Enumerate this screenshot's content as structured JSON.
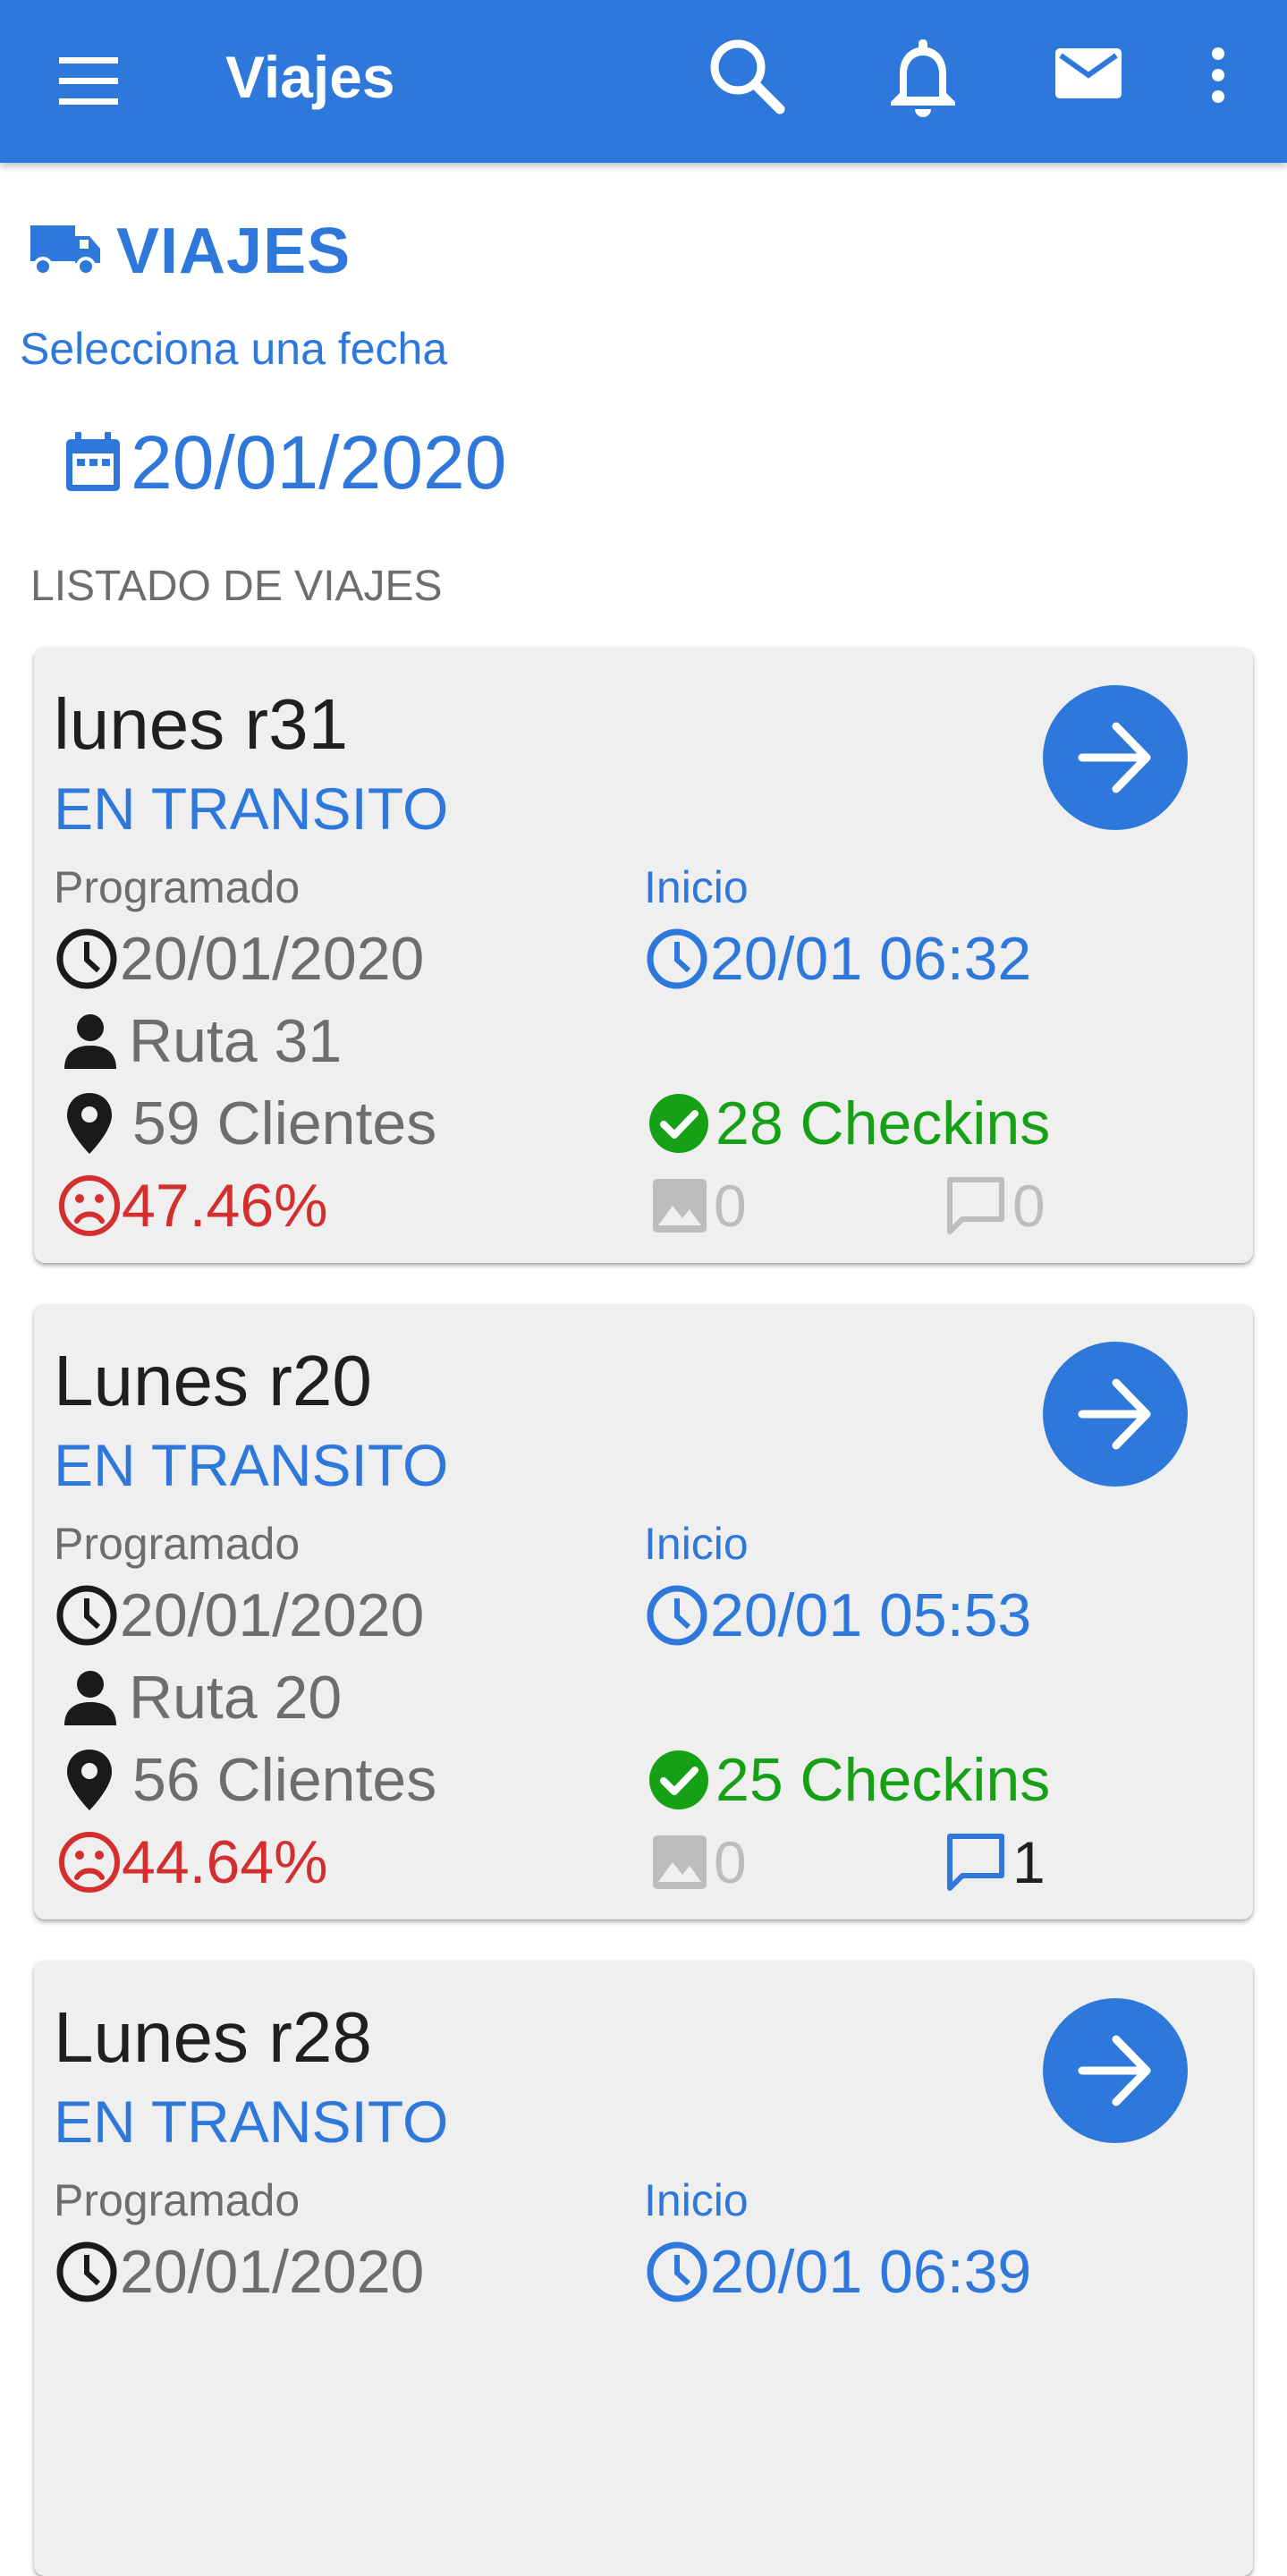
{
  "appbar": {
    "title": "Viajes",
    "icons": [
      "menu-icon",
      "search-icon",
      "bell-icon",
      "mail-icon",
      "more-vert-icon"
    ]
  },
  "section": {
    "title": "VIAJES",
    "icon": "truck-icon"
  },
  "date_select": {
    "label": "Selecciona una fecha",
    "value": "20/01/2020",
    "icon": "calendar-icon"
  },
  "list": {
    "header": "LISTADO DE VIAJES",
    "trips": [
      {
        "name": "lunes r31",
        "status": "EN TRANSITO",
        "scheduled_label": "Programado",
        "scheduled_date": "20/01/2020",
        "route": "Ruta 31",
        "clients": "59 Clientes",
        "percent": "47.46%",
        "start_label": "Inicio",
        "start_time": "20/01 06:32",
        "checkins": "28 Checkins",
        "photos": "0",
        "comments": "0"
      },
      {
        "name": "Lunes r20",
        "status": "EN TRANSITO",
        "scheduled_label": "Programado",
        "scheduled_date": "20/01/2020",
        "route": "Ruta 20",
        "clients": "56 Clientes",
        "percent": "44.64%",
        "start_label": "Inicio",
        "start_time": "20/01 05:53",
        "checkins": "25 Checkins",
        "photos": "0",
        "comments": "1"
      },
      {
        "name": "Lunes r28",
        "status": "EN TRANSITO",
        "scheduled_label": "Programado",
        "scheduled_date": "20/01/2020",
        "start_label": "Inicio",
        "start_time": "20/01 06:39"
      }
    ]
  },
  "colors": {
    "primary": "#2e78dc",
    "success": "#16a016",
    "danger": "#d32f2f",
    "muted": "#6d6d6d",
    "card_bg": "#efefef"
  }
}
